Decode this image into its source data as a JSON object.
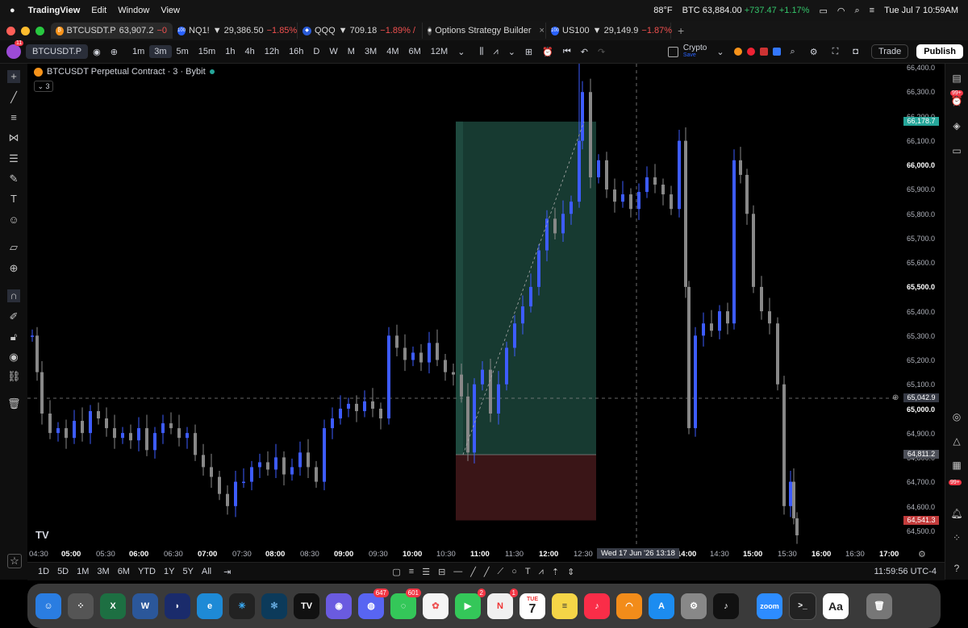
{
  "menubar": {
    "app": "TradingView",
    "items": [
      "Edit",
      "Window",
      "View"
    ],
    "weather": "88°F",
    "ticker_sym": "BTC",
    "ticker_val": "63,884.00",
    "ticker_chg": "+737.47 +1.17%",
    "datetime": "Tue Jul 7  10:59AM"
  },
  "tabs": [
    {
      "label": "BTCUSDT.P",
      "price": "63,907.2",
      "chg": "−0"
    },
    {
      "label": "NQ1!",
      "price": "▼ 29,386.50",
      "chg": "−1.85%"
    },
    {
      "label": "QQQ",
      "price": "▼ 709.18",
      "chg": "−1.89% /"
    },
    {
      "label": "Options Strategy Builder",
      "price": "",
      "chg": ""
    },
    {
      "label": "US100",
      "price": "▼ 29,149.9",
      "chg": "−1.87%"
    }
  ],
  "toolbar": {
    "avatar_badge": "11",
    "symbol": "BTCUSDT.P",
    "intervals": [
      "1m",
      "3m",
      "5m",
      "15m",
      "1h",
      "4h",
      "12h",
      "16h",
      "D",
      "W",
      "M",
      "3M",
      "4M",
      "6M",
      "12M"
    ],
    "selected_interval": "3m",
    "layout_name": "Crypto",
    "layout_sub": "Save",
    "trade_label": "Trade",
    "publish_label": "Publish"
  },
  "chart": {
    "title": "BTCUSDT Perpetual Contract · 3 · Bybit",
    "collapse_count": "3",
    "price_labels": [
      {
        "v": "66,400.0",
        "b": false
      },
      {
        "v": "66,300.0",
        "b": false
      },
      {
        "v": "66,200.0",
        "b": false
      },
      {
        "v": "66,100.0",
        "b": false
      },
      {
        "v": "66,000.0",
        "b": true
      },
      {
        "v": "65,900.0",
        "b": false
      },
      {
        "v": "65,800.0",
        "b": false
      },
      {
        "v": "65,700.0",
        "b": false
      },
      {
        "v": "65,600.0",
        "b": false
      },
      {
        "v": "65,500.0",
        "b": true
      },
      {
        "v": "65,400.0",
        "b": false
      },
      {
        "v": "65,300.0",
        "b": false
      },
      {
        "v": "65,200.0",
        "b": false
      },
      {
        "v": "65,100.0",
        "b": false
      },
      {
        "v": "65,000.0",
        "b": true
      },
      {
        "v": "64,900.0",
        "b": false
      },
      {
        "v": "64,800.0",
        "b": false
      },
      {
        "v": "64,700.0",
        "b": false
      },
      {
        "v": "64,600.0",
        "b": false
      },
      {
        "v": "64,500.0",
        "b": false
      }
    ],
    "tag_target": "66,178.7",
    "tag_cursor": "65,042.9",
    "tag_entry": "64,811.2",
    "tag_stop": "64,541.3",
    "time_labels": [
      {
        "t": "04:30",
        "b": false
      },
      {
        "t": "05:00",
        "b": true
      },
      {
        "t": "05:30",
        "b": false
      },
      {
        "t": "06:00",
        "b": true
      },
      {
        "t": "06:30",
        "b": false
      },
      {
        "t": "07:00",
        "b": true
      },
      {
        "t": "07:30",
        "b": false
      },
      {
        "t": "08:00",
        "b": true
      },
      {
        "t": "08:30",
        "b": false
      },
      {
        "t": "09:00",
        "b": true
      },
      {
        "t": "09:30",
        "b": false
      },
      {
        "t": "10:00",
        "b": true
      },
      {
        "t": "10:30",
        "b": false
      },
      {
        "t": "11:00",
        "b": true
      },
      {
        "t": "11:30",
        "b": false
      },
      {
        "t": "12:00",
        "b": true
      },
      {
        "t": "12:30",
        "b": false
      },
      {
        "t": "14:00",
        "b": true
      },
      {
        "t": "14:30",
        "b": false
      },
      {
        "t": "15:00",
        "b": true
      },
      {
        "t": "15:30",
        "b": false
      },
      {
        "t": "16:00",
        "b": true
      },
      {
        "t": "16:30",
        "b": false
      },
      {
        "t": "17:00",
        "b": true
      }
    ],
    "cursor_time": "Wed 17 Jun '26   13:18"
  },
  "bottom": {
    "ranges": [
      "1D",
      "5D",
      "1M",
      "3M",
      "6M",
      "YTD",
      "1Y",
      "5Y",
      "All"
    ],
    "clock": "11:59:56 UTC-4"
  },
  "right_badges": [
    "99+",
    "99+"
  ],
  "dock": {
    "discord_badge": "647",
    "messages_badge": "601",
    "facetime_badge": "2",
    "news_badge": "1",
    "calendar_month": "TUE",
    "calendar_day": "7",
    "zoom_label": "zoom",
    "dict_label": "Aa"
  },
  "colors": {
    "up": "#3d5cff",
    "down": "#888888",
    "profit_zone": "#173a31",
    "loss_zone": "#3a1517",
    "accent": "#2962ff"
  }
}
